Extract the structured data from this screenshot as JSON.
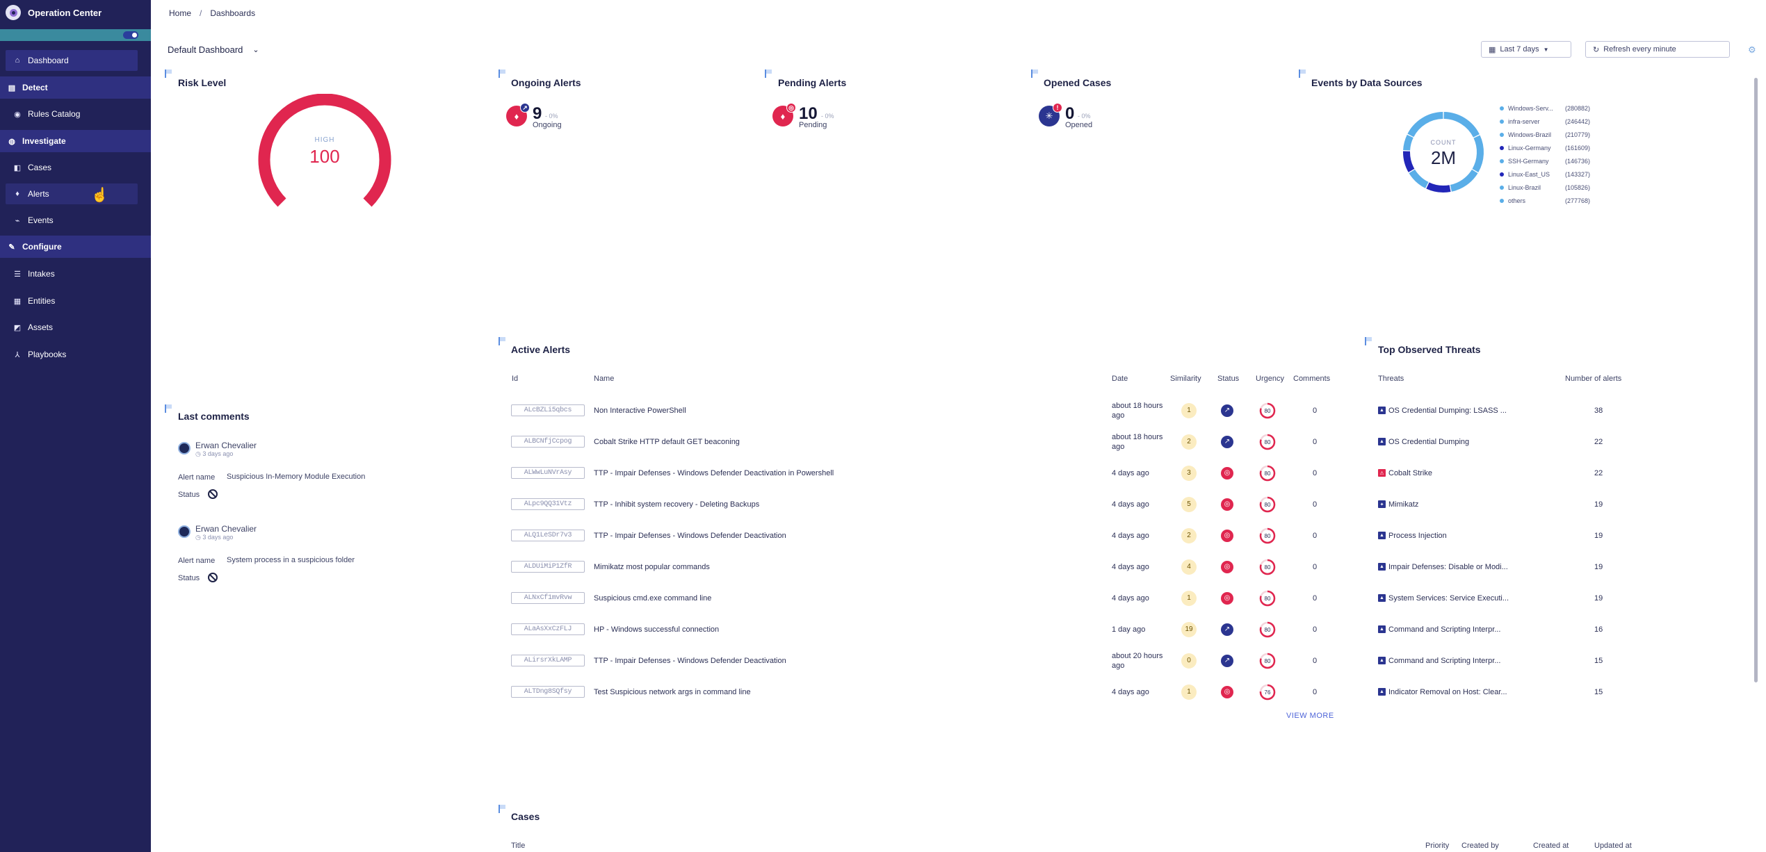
{
  "sidebar": {
    "brand": "Operation Center",
    "items": {
      "dashboard": "Dashboard",
      "detect": "Detect",
      "rules_catalog": "Rules Catalog",
      "investigate": "Investigate",
      "cases": "Cases",
      "alerts": "Alerts",
      "events": "Events",
      "configure": "Configure",
      "intakes": "Intakes",
      "entities": "Entities",
      "assets": "Assets",
      "playbooks": "Playbooks"
    }
  },
  "header": {
    "breadcrumb": [
      "Home",
      "/",
      "Dashboards"
    ],
    "dashboard_name": "Default Dashboard",
    "date_range": "Last 7 days",
    "refresh": "Refresh every minute"
  },
  "risk": {
    "title": "Risk Level",
    "level": "HIGH",
    "value": "100",
    "fraction": 1.0,
    "color": "#e0264f"
  },
  "ongoing": {
    "title": "Ongoing Alerts",
    "value": "9",
    "delta": "- 0%",
    "sub": "Ongoing"
  },
  "pending": {
    "title": "Pending Alerts",
    "value": "10",
    "delta": "- 0%",
    "sub": "Pending"
  },
  "opened": {
    "title": "Opened Cases",
    "value": "0",
    "delta": "- 0%",
    "sub": "Opened",
    "badge": "!"
  },
  "sources": {
    "title": "Events by Data Sources",
    "count_label": "COUNT",
    "count_value": "2M",
    "legend": [
      {
        "name": "Windows-Serv...",
        "count": "(280882)",
        "color": "#5aaee8"
      },
      {
        "name": "infra-server",
        "count": "(246442)",
        "color": "#5aaee8"
      },
      {
        "name": "Windows-Brazil",
        "count": "(210779)",
        "color": "#5aaee8"
      },
      {
        "name": "Linux-Germany",
        "count": "(161609)",
        "color": "#2226b8"
      },
      {
        "name": "SSH-Germany",
        "count": "(146736)",
        "color": "#5aaee8"
      },
      {
        "name": "Linux-East_US",
        "count": "(143327)",
        "color": "#2226b8"
      },
      {
        "name": "Linux-Brazil",
        "count": "(105826)",
        "color": "#5aaee8"
      },
      {
        "name": "others",
        "count": "(277768)",
        "color": "#5aaee8"
      }
    ]
  },
  "active_alerts": {
    "title": "Active Alerts",
    "columns": [
      "Id",
      "Name",
      "Date",
      "Similarity",
      "Status",
      "Urgency",
      "Comments"
    ],
    "rows": [
      {
        "id": "ALcBZLi5qbcs",
        "name": "Non Interactive PowerShell",
        "date": "about 18 hours ago",
        "similarity": "1",
        "status": "ongoing",
        "urgency": "80",
        "urgency_frac": 0.8,
        "comments": "0"
      },
      {
        "id": "ALBCNfjCcpog",
        "name": "Cobalt Strike HTTP default GET beaconing",
        "date": "about 18 hours ago",
        "similarity": "2",
        "status": "ongoing",
        "urgency": "80",
        "urgency_frac": 0.8,
        "comments": "0"
      },
      {
        "id": "ALWwLuNVrAsy",
        "name": "TTP - Impair Defenses - Windows Defender Deactivation in Powershell",
        "date": "4 days ago",
        "similarity": "3",
        "status": "pending",
        "urgency": "80",
        "urgency_frac": 0.8,
        "comments": "0"
      },
      {
        "id": "ALpc9QQ31Vtz",
        "name": "TTP - Inhibit system recovery - Deleting Backups",
        "date": "4 days ago",
        "similarity": "5",
        "status": "pending",
        "urgency": "80",
        "urgency_frac": 0.8,
        "comments": "0"
      },
      {
        "id": "ALQ1LeSDr7v3",
        "name": "TTP - Impair Defenses - Windows Defender Deactivation",
        "date": "4 days ago",
        "similarity": "2",
        "status": "pending",
        "urgency": "80",
        "urgency_frac": 0.8,
        "comments": "0"
      },
      {
        "id": "ALDUiMiP1ZfR",
        "name": "Mimikatz most popular commands",
        "date": "4 days ago",
        "similarity": "4",
        "status": "pending",
        "urgency": "80",
        "urgency_frac": 0.8,
        "comments": "0"
      },
      {
        "id": "ALNxCf1mvRvw",
        "name": "Suspicious cmd.exe command line",
        "date": "4 days ago",
        "similarity": "1",
        "status": "pending",
        "urgency": "80",
        "urgency_frac": 0.8,
        "comments": "0"
      },
      {
        "id": "ALaAsXxCzFLJ",
        "name": "HP - Windows successful connection",
        "date": "1 day ago",
        "similarity": "19",
        "status": "ongoing",
        "urgency": "80",
        "urgency_frac": 0.8,
        "comments": "0"
      },
      {
        "id": "ALirsrXkLAMP",
        "name": "TTP - Impair Defenses - Windows Defender Deactivation",
        "date": "about 20 hours ago",
        "similarity": "0",
        "status": "ongoing",
        "urgency": "80",
        "urgency_frac": 0.8,
        "comments": "0"
      },
      {
        "id": "ALTDng8SQfsy",
        "name": "Test Suspicious network args in command line",
        "date": "4 days ago",
        "similarity": "1",
        "status": "pending",
        "urgency": "76",
        "urgency_frac": 0.76,
        "comments": "0"
      }
    ],
    "view_more": "VIEW MORE"
  },
  "threats": {
    "title": "Top Observed Threats",
    "columns": [
      "Threats",
      "Number of alerts"
    ],
    "rows": [
      {
        "name": "OS Credential Dumping: LSASS ...",
        "count": "38",
        "icon": "technique"
      },
      {
        "name": "OS Credential Dumping",
        "count": "22",
        "icon": "technique"
      },
      {
        "name": "Cobalt Strike",
        "count": "22",
        "icon": "malware"
      },
      {
        "name": "Mimikatz",
        "count": "19",
        "icon": "tool"
      },
      {
        "name": "Process Injection",
        "count": "19",
        "icon": "technique"
      },
      {
        "name": "Impair Defenses: Disable or Modi...",
        "count": "19",
        "icon": "technique"
      },
      {
        "name": "System Services: Service Executi...",
        "count": "19",
        "icon": "technique"
      },
      {
        "name": "Command and Scripting Interpr...",
        "count": "16",
        "icon": "technique"
      },
      {
        "name": "Command and Scripting Interpr...",
        "count": "15",
        "icon": "technique"
      },
      {
        "name": "Indicator Removal on Host: Clear...",
        "count": "15",
        "icon": "technique"
      }
    ]
  },
  "comments": {
    "title": "Last comments",
    "alert_name_label": "Alert name",
    "status_label": "Status",
    "items": [
      {
        "author": "Erwan Chevalier",
        "date": "3 days ago",
        "alert_name": "Suspicious In-Memory Module Execution"
      },
      {
        "author": "Erwan Chevalier",
        "date": "3 days ago",
        "alert_name": "System process in a suspicious folder"
      }
    ]
  },
  "cases": {
    "title": "Cases",
    "columns": [
      "Title",
      "Priority",
      "Created by",
      "Created at",
      "Updated at"
    ]
  },
  "colors": {
    "ongoing": "#2b3590",
    "pending": "#e0264f",
    "urgency": "#e0264f",
    "accent": "#4d63d8"
  }
}
